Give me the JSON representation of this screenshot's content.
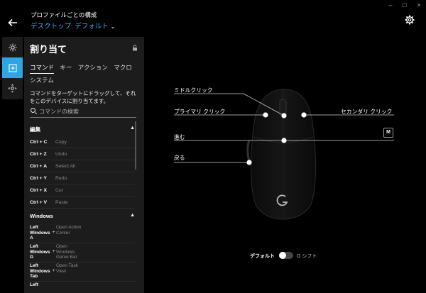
{
  "window": {
    "minimize_glyph": "–",
    "maximize_glyph": "□",
    "close_glyph": "×"
  },
  "header": {
    "back_icon": "arrow-left-icon",
    "profile_heading": "プロファイルごとの構成",
    "profile_name": "デスクトップ: デフォルト",
    "settings_icon": "gear-icon"
  },
  "rail": [
    {
      "icon": "lighting-icon",
      "active": false
    },
    {
      "icon": "assignment-plus-icon",
      "active": true
    },
    {
      "icon": "dpi-move-icon",
      "active": false
    }
  ],
  "panel": {
    "title": "割り当て",
    "tabs": [
      "コマンド",
      "キー",
      "アクション",
      "マクロ",
      "システム"
    ],
    "active_tab": "コマンド",
    "description": "コマンドをターゲットにドラッグして、それをこのデバイスに割り当てます。",
    "search_placeholder": "コマンドの検索",
    "edit_section": "編集",
    "edit_rows": [
      {
        "key": "Ctrl + C",
        "action": "Copy"
      },
      {
        "key": "Ctrl + Z",
        "action": "Undo"
      },
      {
        "key": "Ctrl + A",
        "action": "Select All"
      },
      {
        "key": "Ctrl + Y",
        "action": "Redo"
      },
      {
        "key": "Ctrl + X",
        "action": "Cut"
      },
      {
        "key": "Ctrl + V",
        "action": "Paste"
      }
    ],
    "windows_section": "Windows",
    "windows_rows": [
      {
        "key": "Left Windows A",
        "plus": "+",
        "action": "Open Action Center"
      },
      {
        "key": "Left Windows G",
        "plus": "+",
        "action": "Open Windows Game Bar"
      },
      {
        "key": "Left Windows Tab",
        "plus": "+",
        "action": "Open Task View"
      },
      {
        "key": "Left",
        "plus": "",
        "action": ""
      }
    ]
  },
  "callouts": {
    "middle_click": "ミドルクリック",
    "primary_click": "プライマリ クリック",
    "secondary_click": "セカンダリ クリック",
    "forward": "進む",
    "back": "戻る"
  },
  "onboard_badge": "M",
  "mode_toggle": {
    "left_label": "デフォルト",
    "right_label": "G シフト",
    "g_shift_on": false
  }
}
